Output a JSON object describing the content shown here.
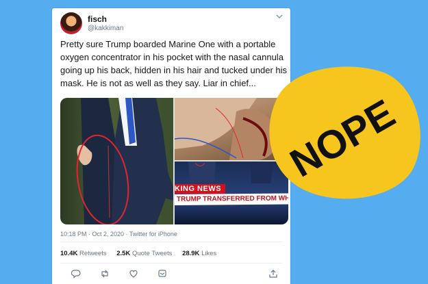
{
  "tweet": {
    "display_name": "fisch",
    "handle": "@kakkiman",
    "text": "Pretty sure Trump boarded Marine One with a portable oxygen concentrator in his pocket with the nasal cannula going up his back, hidden in his hair and tucked under his mask. He is not as well as they say. Liar in chief...",
    "meta": "10:18 PM · Oct 2, 2020 · Twitter for iPhone",
    "stats": {
      "retweets_count": "10.4K",
      "retweets_label": "Retweets",
      "quote_count": "2.5K",
      "quote_label": "Quote Tweets",
      "likes_count": "28.9K",
      "likes_label": "Likes"
    },
    "media": {
      "ticker_top": "KING NEWS",
      "ticker_bottom": "TRUMP TRANSFERRED FROM WH TO WALTE"
    },
    "actions": [
      "reply-icon",
      "retweet-icon",
      "like-icon",
      "dm-icon",
      "share-icon"
    ]
  },
  "sticker": {
    "label": "NOPE",
    "color": "#f6c51e"
  },
  "colors": {
    "background": "#55acee",
    "text": "#14171a",
    "muted": "#657786",
    "annotation": "#e0262e"
  }
}
